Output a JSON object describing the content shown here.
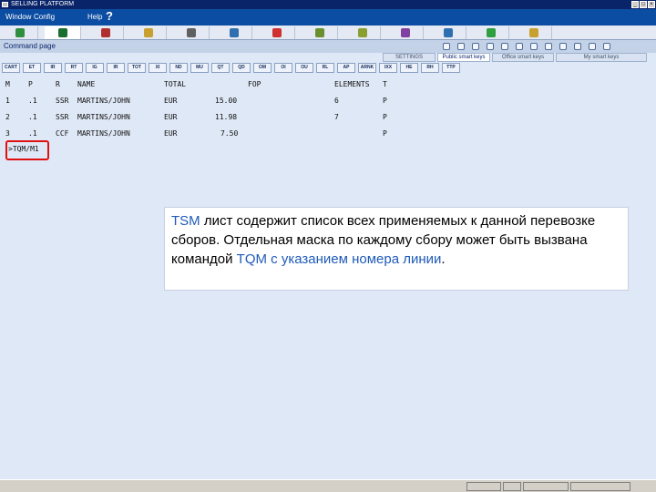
{
  "window": {
    "title": "SELLING PLATFORM"
  },
  "menu": {
    "window_label": "Window",
    "config_label": "Config",
    "help_label": "Help",
    "help_glyph": "?"
  },
  "toolbar": {
    "icons": [
      "book-icon",
      "notebook-icon",
      "person-icon",
      "car-icon",
      "grid-icon",
      "printer-icon",
      "agent-icon",
      "pin-icon",
      "puzzle-icon",
      "doc-check-icon",
      "globe-icon",
      "info-icon",
      "bookmark-icon"
    ],
    "colors": [
      "#2f8f3f",
      "#1a6e2e",
      "#b03030",
      "#c8a030",
      "#606060",
      "#2f6fb0",
      "#d03030",
      "#6a8f2f",
      "#8a9f2f",
      "#8040a0",
      "#2f6fb0",
      "#2f9f3f",
      "#c8a030"
    ]
  },
  "command_page": {
    "label": "Command page"
  },
  "right_tabs": [
    "SETTINGS",
    "Public smart keys",
    "Office smart keys",
    "My smart keys"
  ],
  "function_keys": [
    "CART",
    "ET",
    "IR",
    "RT",
    "IG",
    "IR",
    "TOT",
    "XI",
    "ND",
    "MU",
    "QT",
    "QD",
    "OM",
    "OI",
    "OU",
    "RL",
    "AP",
    "ARNK",
    "IXX",
    "HE",
    "RH",
    "TTP"
  ],
  "tsm": {
    "headers": {
      "m": "M",
      "p": "P",
      "r": "R",
      "name": "NAME",
      "total": "TOTAL",
      "fop": "FOP",
      "elements": "ELEMENTS",
      "t": "T"
    },
    "rows": [
      {
        "m": "1",
        "p": ".1",
        "r": "SSR",
        "name": "MARTINS/JOHN",
        "cur": "EUR",
        "amount": "15.00",
        "elements": "6",
        "t": "P"
      },
      {
        "m": "2",
        "p": ".1",
        "r": "SSR",
        "name": "MARTINS/JOHN",
        "cur": "EUR",
        "amount": "11.98",
        "elements": "7",
        "t": "P"
      },
      {
        "m": "3",
        "p": ".1",
        "r": "CCF",
        "name": "MARTINS/JOHN",
        "cur": "EUR",
        "amount": "7.50",
        "elements": "",
        "t": "P"
      }
    ],
    "command": ">TQM/M1"
  },
  "note": {
    "tsm": "TSM",
    "text1": " лист содержит список всех применяемых к данной перевозке сборов. Отдельная маска по каждому сбору может быть вызвана командой ",
    "tqm": "TQM с указанием номера линии",
    "text2": "."
  }
}
